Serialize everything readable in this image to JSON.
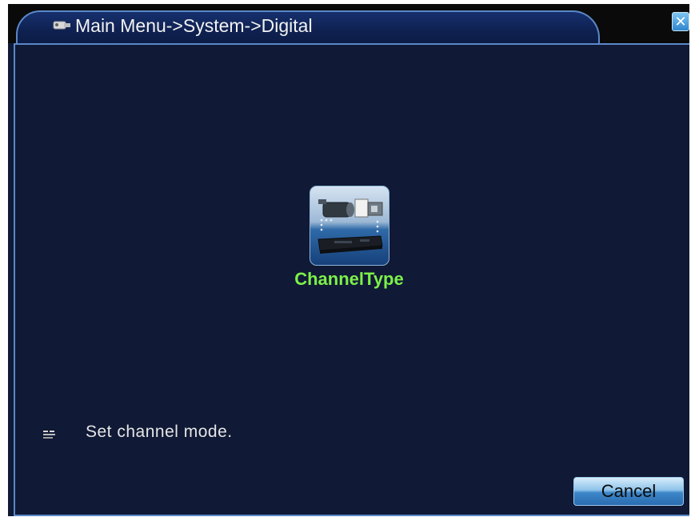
{
  "window": {
    "title": "Main Menu->System->Digital",
    "close_symbol": "✕"
  },
  "menu": {
    "items": [
      {
        "label": "ChannelType",
        "icon": "camera-dvr-icon"
      }
    ]
  },
  "hint": {
    "text": "Set channel mode.",
    "icon": "info-icon"
  },
  "buttons": {
    "cancel_label": "Cancel"
  },
  "colors": {
    "background": "#101935",
    "border_accent": "#5a88c8",
    "item_label": "#7cf04a",
    "text": "#e6e6e6"
  }
}
